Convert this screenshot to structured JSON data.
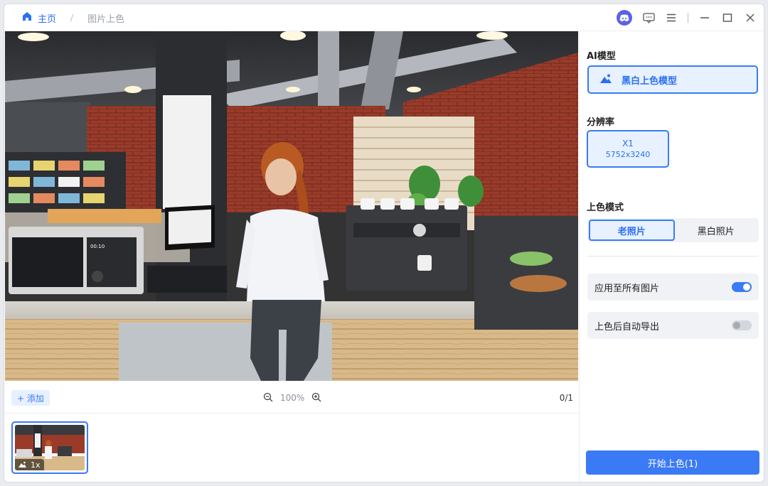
{
  "header": {
    "home_label": "主页",
    "separator": "/",
    "current_page": "图片上色"
  },
  "preview": {
    "scene": "cafe-interior-photo"
  },
  "bottombar": {
    "add_label": "+ 添加",
    "zoom_level": "100%",
    "counter": "0/1"
  },
  "thumbnails": [
    {
      "badge": "1x"
    }
  ],
  "panel": {
    "ai_model_title": "AI模型",
    "ai_model_value": "黑白上色模型",
    "resolution_title": "分辨率",
    "resolution_main": "X1",
    "resolution_sub": "5752x3240",
    "mode_title": "上色模式",
    "modes": [
      "老照片",
      "黑白照片"
    ],
    "active_mode": "老照片",
    "apply_all_label": "应用至所有图片",
    "apply_all_on": true,
    "auto_export_label": "上色后自动导出",
    "auto_export_on": false,
    "start_label": "开始上色(1)"
  },
  "colors": {
    "accent": "#3b7af5",
    "accent_light": "#e7f1ff",
    "discord": "#5b62e8"
  }
}
